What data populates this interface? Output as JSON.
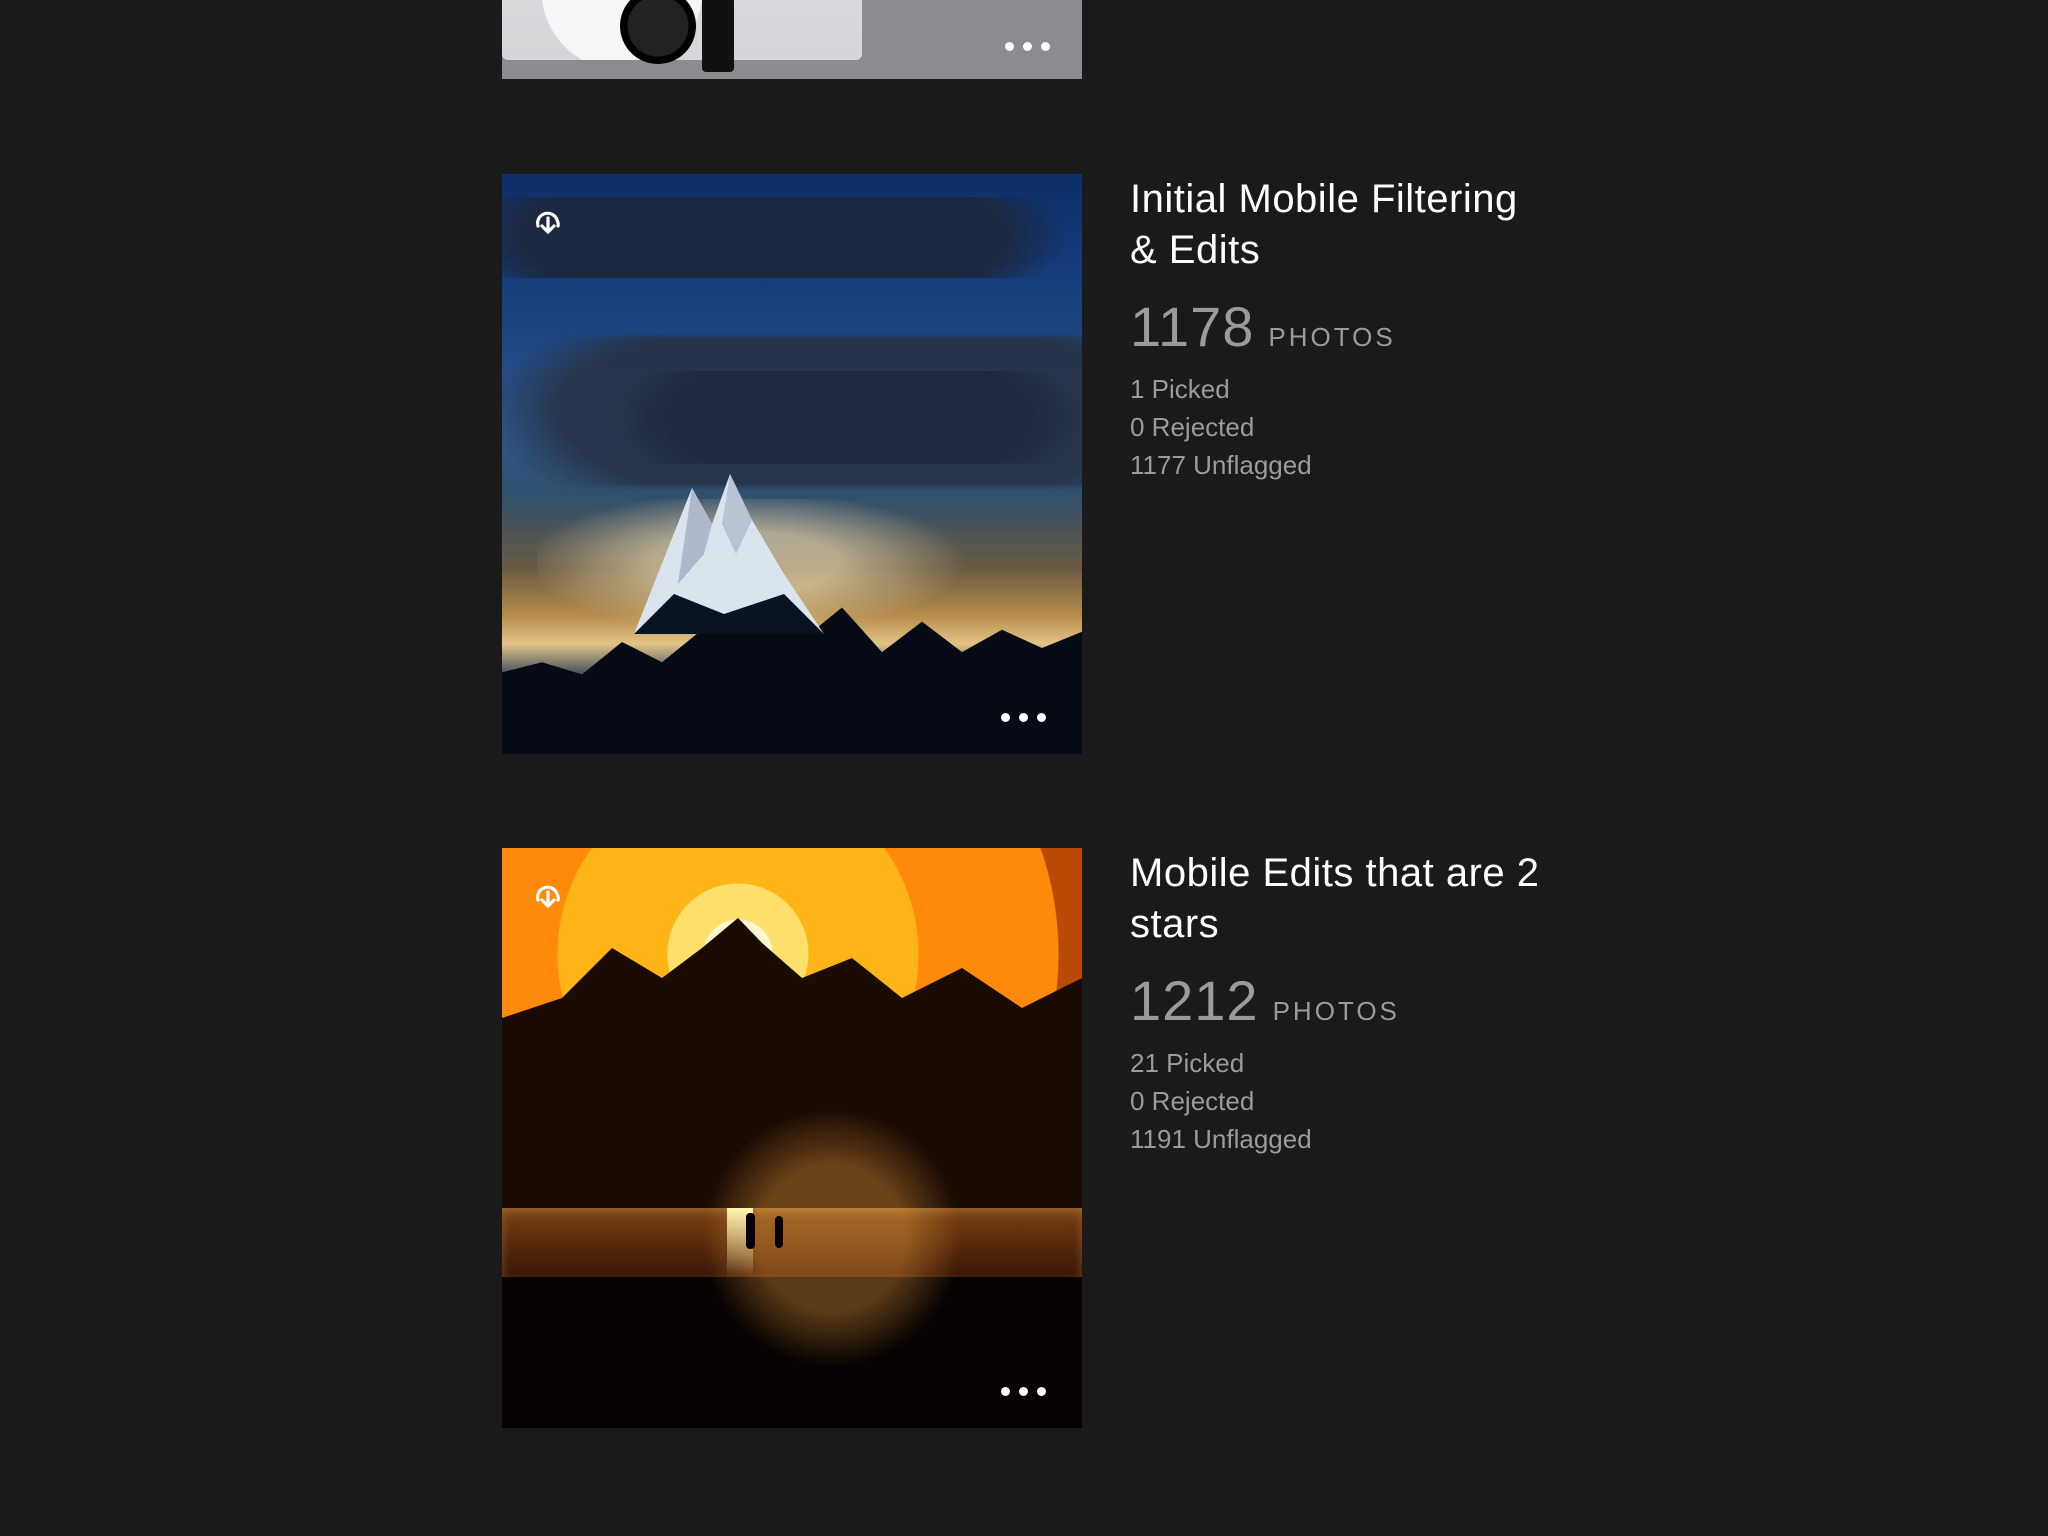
{
  "photos_label": "PHOTOS",
  "collections": [
    {
      "title": "",
      "photo_count": "",
      "picked": "",
      "rejected": "",
      "unflagged": ""
    },
    {
      "title": "Initial Mobile Filtering & Edits",
      "photo_count": "1178",
      "picked": "1 Picked",
      "rejected": "0 Rejected",
      "unflagged": "1177 Unflagged"
    },
    {
      "title": "Mobile Edits that are 2 stars",
      "photo_count": "1212",
      "picked": "21 Picked",
      "rejected": "0 Rejected",
      "unflagged": "1191 Unflagged"
    }
  ]
}
